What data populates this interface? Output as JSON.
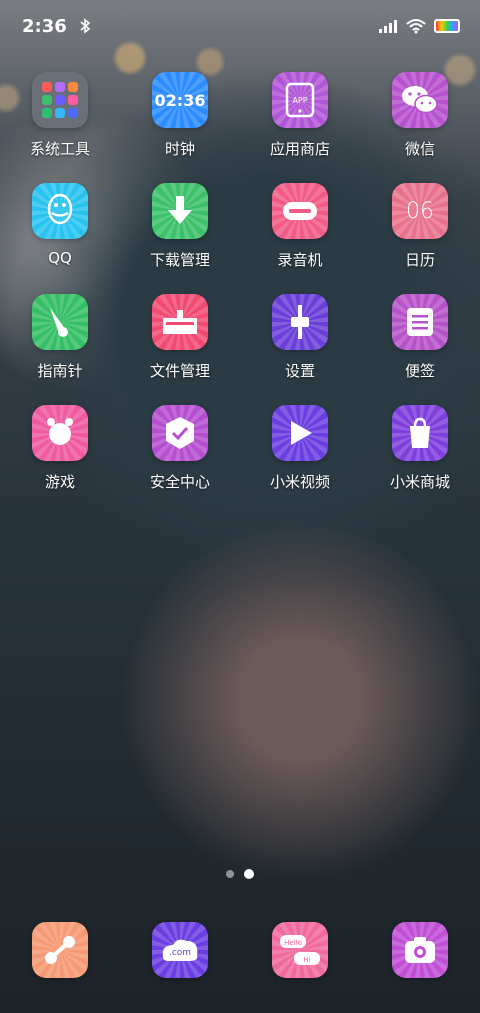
{
  "status_bar": {
    "time": "2:36",
    "icons": [
      "bluetooth-icon",
      "signal-icon",
      "wifi-icon",
      "battery-icon"
    ]
  },
  "apps": [
    {
      "name": "系统工具",
      "icon": "system-tools-folder-icon",
      "color": "#6a6f78"
    },
    {
      "name": "时钟",
      "icon": "clock-icon",
      "color": "#2b8cff",
      "display": "02:36"
    },
    {
      "name": "应用商店",
      "icon": "app-store-icon",
      "color": "#b156d6",
      "badge": "APP"
    },
    {
      "name": "微信",
      "icon": "wechat-icon",
      "color": "#b752cf"
    },
    {
      "name": "QQ",
      "icon": "qq-penguin-icon",
      "color": "#29c3f0"
    },
    {
      "name": "下载管理",
      "icon": "download-arrow-icon",
      "color": "#3cc06a"
    },
    {
      "name": "录音机",
      "icon": "recorder-icon",
      "color": "#f25b86"
    },
    {
      "name": "日历",
      "icon": "calendar-icon",
      "color": "#e8718d",
      "display": "06"
    },
    {
      "name": "指南针",
      "icon": "compass-icon",
      "color": "#34bf66"
    },
    {
      "name": "文件管理",
      "icon": "file-manager-icon",
      "color": "#f14b72"
    },
    {
      "name": "设置",
      "icon": "settings-slider-icon",
      "color": "#6a3ed8"
    },
    {
      "name": "便签",
      "icon": "notes-icon",
      "color": "#b753c8"
    },
    {
      "name": "游戏",
      "icon": "game-icon",
      "color": "#ef5aa0"
    },
    {
      "name": "安全中心",
      "icon": "security-shield-icon",
      "color": "#b54fd0"
    },
    {
      "name": "小米视频",
      "icon": "video-play-icon",
      "color": "#6a3ee0"
    },
    {
      "name": "小米商城",
      "icon": "shopping-bag-icon",
      "color": "#7f3fdc"
    }
  ],
  "dock": [
    {
      "icon": "share-icon",
      "color": "#f59a74"
    },
    {
      "icon": "browser-icon",
      "color": "#6a3ee0",
      "badge": ".com"
    },
    {
      "icon": "messages-icon",
      "color": "#f06a9c",
      "bubbles": [
        "Hello",
        "Hi"
      ]
    },
    {
      "icon": "camera-icon",
      "color": "#c04fd6"
    }
  ],
  "page_indicator": {
    "count": 2,
    "active": 2
  }
}
